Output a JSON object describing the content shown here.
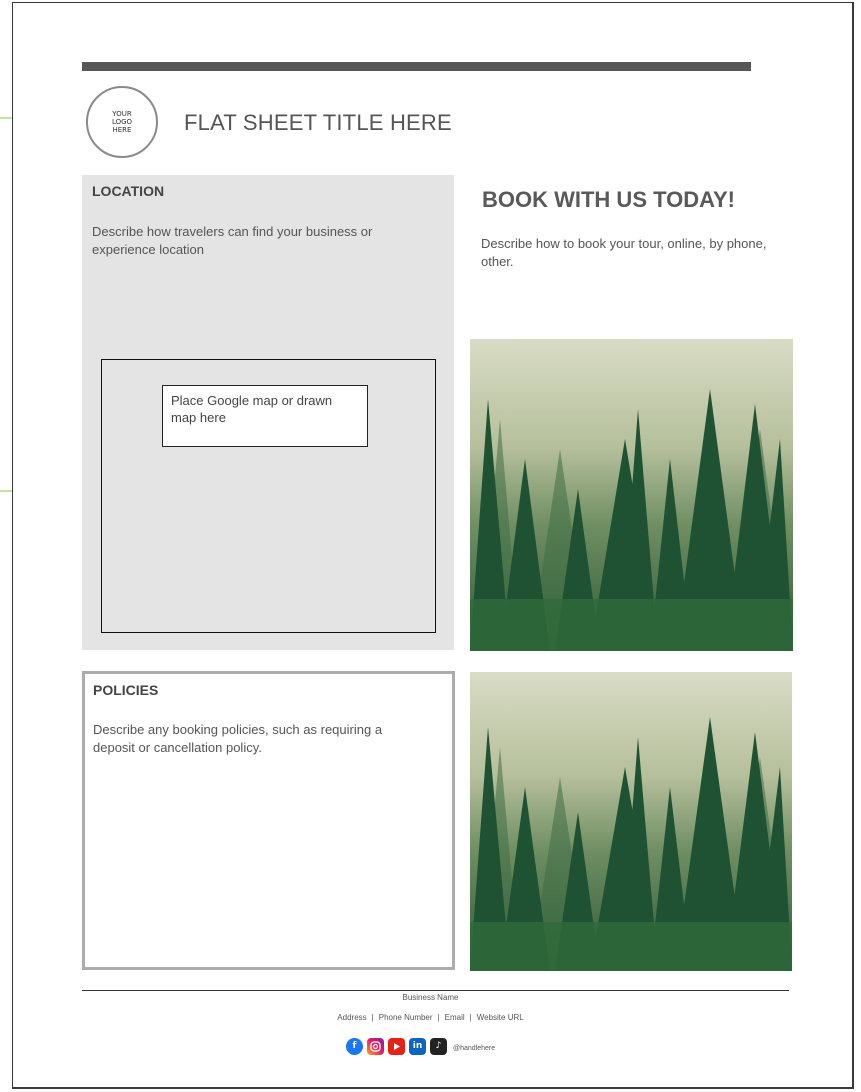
{
  "header": {
    "logo_text": "YOUR LOGO HERE",
    "title": "FLAT SHEET TITLE HERE"
  },
  "location": {
    "heading": "LOCATION",
    "description": "Describe how travelers can find your business or experience location",
    "map_placeholder": "Place Google map or drawn map here"
  },
  "booking": {
    "heading": "BOOK WITH US TODAY!",
    "description": "Describe how to book your tour, online, by phone, other."
  },
  "policies": {
    "heading": "POLICIES",
    "description": "Describe any booking policies, such as requiring a deposit or cancellation policy."
  },
  "footer": {
    "business_name": "Business Name",
    "address": "Address",
    "phone": "Phone Number",
    "email": "Email",
    "website": "Website URL",
    "social_icons": [
      "facebook-icon",
      "instagram-icon",
      "youtube-icon",
      "linkedin-icon",
      "tiktok-icon"
    ],
    "handle": "@handlehere"
  },
  "colors": {
    "accent_arrow": "#8dc63f",
    "header_bar": "#565656",
    "panel_gray": "#e4e4e4",
    "border_gray": "#acacac"
  }
}
